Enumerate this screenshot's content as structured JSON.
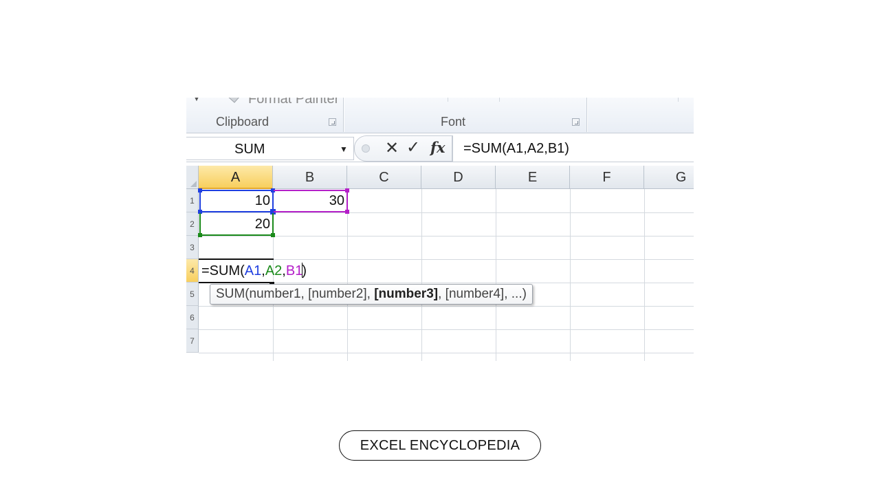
{
  "ribbon": {
    "format_painter_label": "Format Painter",
    "groups": [
      {
        "label": "Clipboard"
      },
      {
        "label": "Font"
      }
    ]
  },
  "formula_bar": {
    "name_box": "SUM",
    "formula": "=SUM(A1,A2,B1)"
  },
  "grid": {
    "columns": [
      "A",
      "B",
      "C",
      "D",
      "E",
      "F",
      "G"
    ],
    "row_labels": [
      "1",
      "2",
      "3",
      "4",
      "5",
      "6",
      "7"
    ],
    "active_column": "A",
    "active_row": "4",
    "cells": {
      "A1": "10",
      "B1": "30",
      "A2": "20"
    },
    "edit": {
      "prefix": "=SUM(",
      "ref1": "A1",
      "sep1": ",",
      "ref2": "A2",
      "sep2": ",",
      "ref3": "B1",
      "close": ")"
    },
    "ref_colors": {
      "A1": "#1f3fe0",
      "A2": "#1a8a1a",
      "B1": "#b41fc8"
    }
  },
  "tooltip": {
    "part1": "SUM(number1, [number2], ",
    "bold": "[number3]",
    "part2": ", [number4], ...)"
  },
  "footer": {
    "badge": "EXCEL ENCYCLOPEDIA"
  }
}
